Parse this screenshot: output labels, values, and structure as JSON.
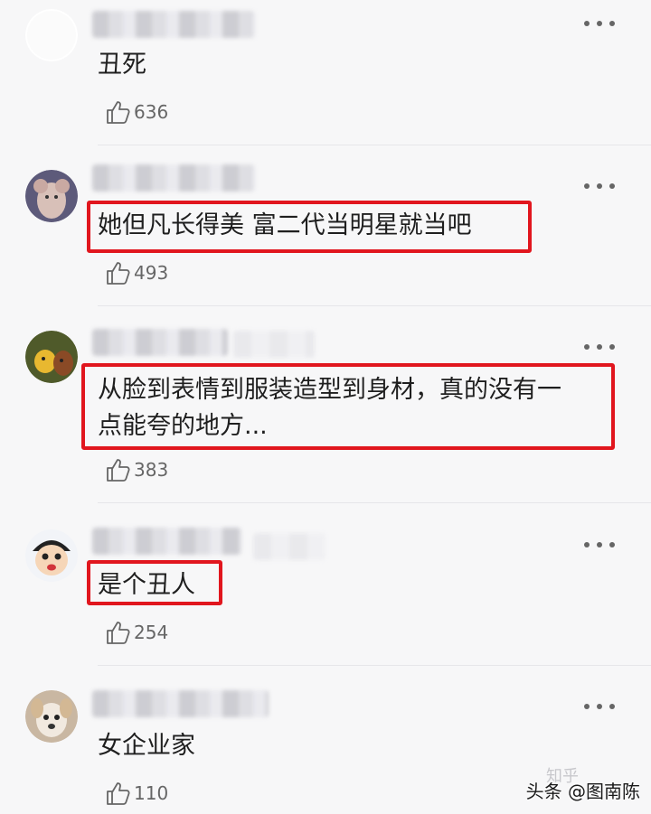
{
  "comments": [
    {
      "text": "丑死",
      "likes": "636"
    },
    {
      "text": "她但凡长得美  富二代当明星就当吧",
      "likes": "493"
    },
    {
      "text_line1": "从脸到表情到服装造型到身材，真的没有一",
      "text_line2": "点能夸的地方...",
      "likes": "383"
    },
    {
      "text": "是个丑人",
      "likes": "254"
    },
    {
      "text": "女企业家",
      "likes": "110"
    }
  ],
  "watermark": "头条 @图南陈",
  "watermark_ghost": "知乎",
  "icons": [
    "thumbs-up-icon",
    "more-dots-icon"
  ],
  "colors": {
    "highlight": "#e1161e",
    "background": "#f7f7f8"
  }
}
